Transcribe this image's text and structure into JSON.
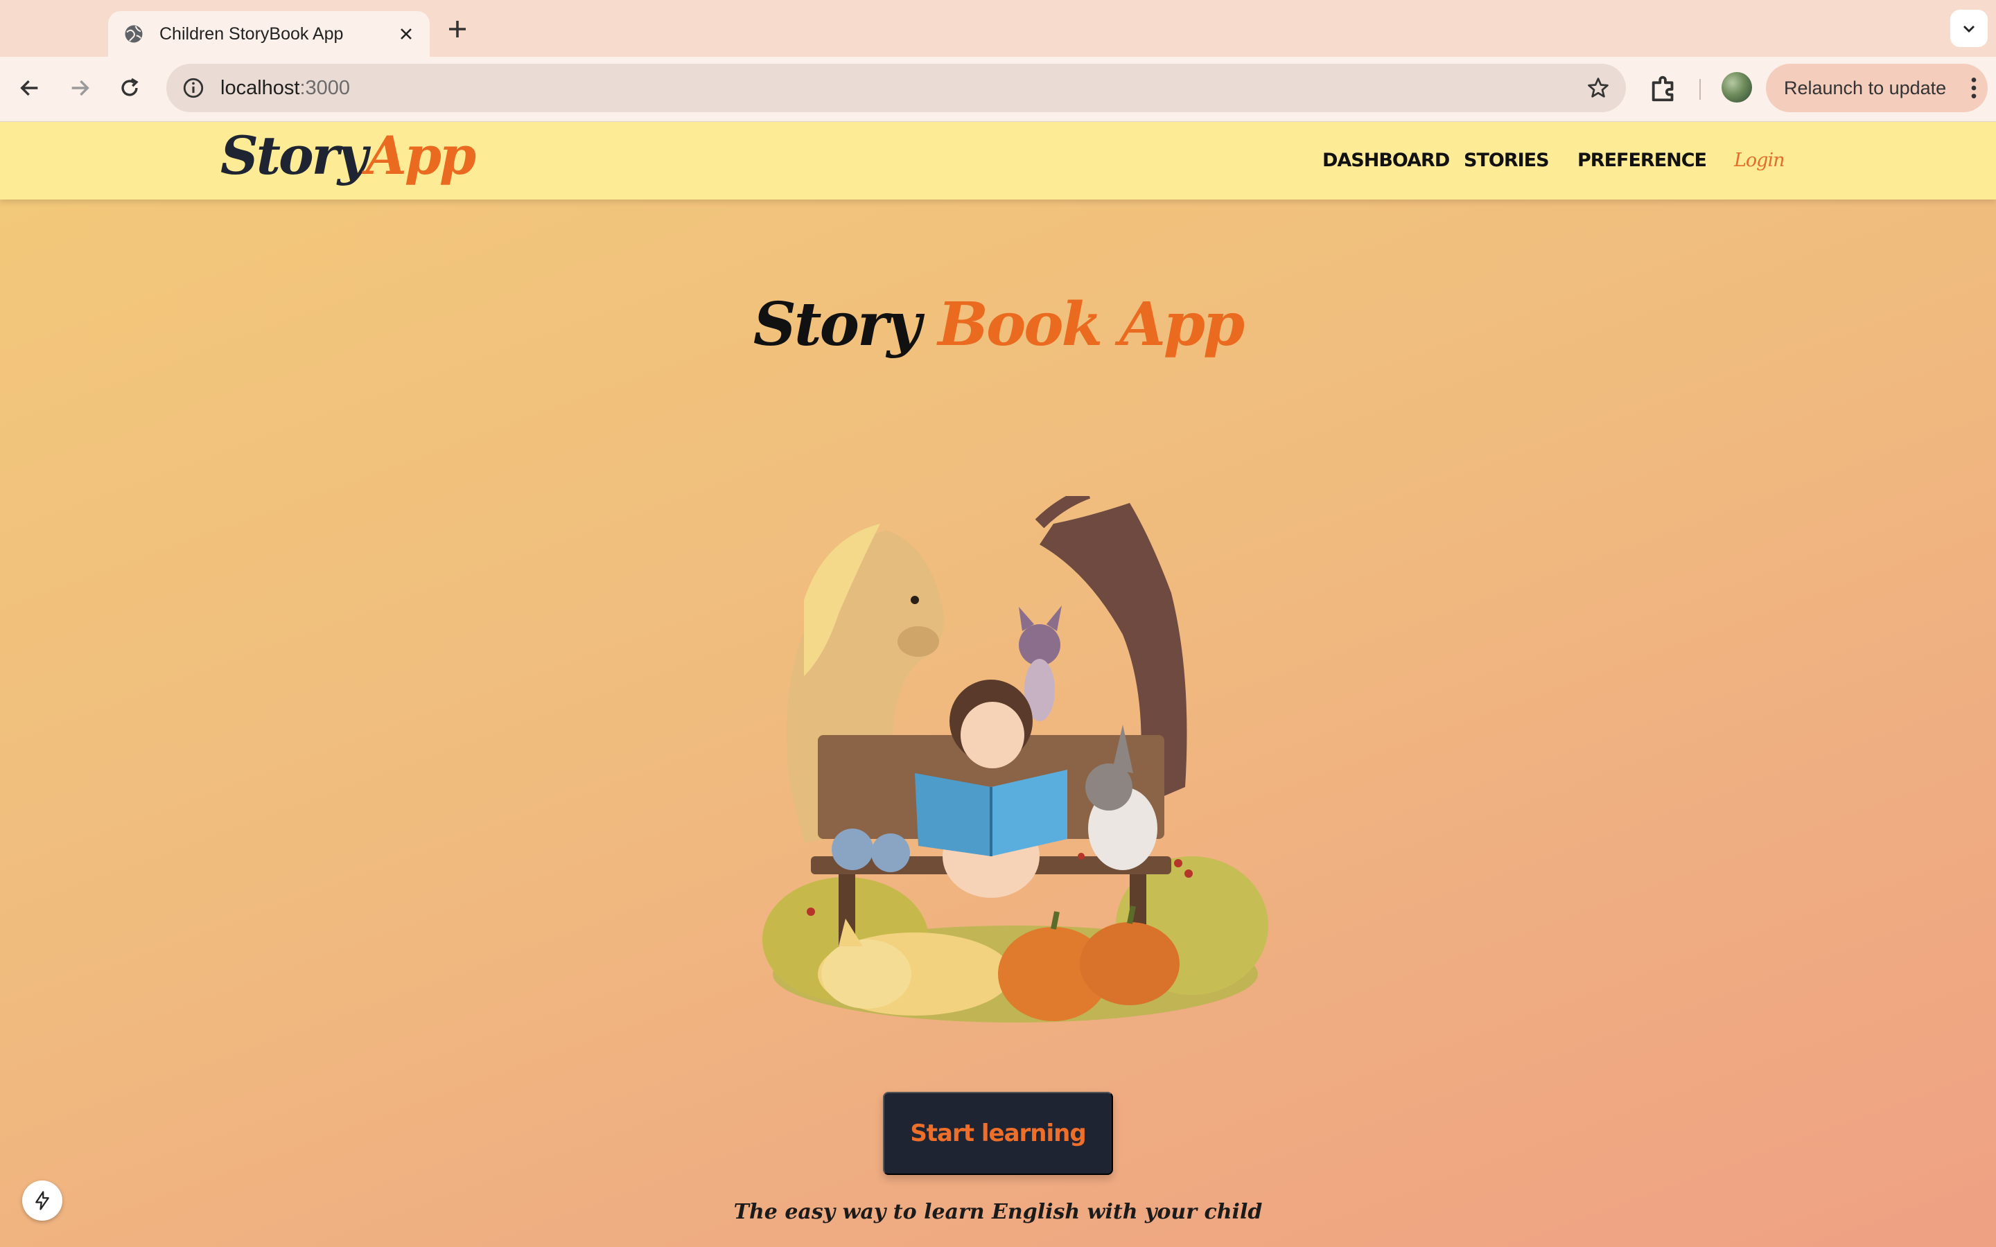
{
  "browser": {
    "tab_title": "Children StoryBook App",
    "url_host": "localhost",
    "url_port": ":3000",
    "relaunch_label": "Relaunch to update"
  },
  "nav": {
    "logo_part1": "Story",
    "logo_part2": "App",
    "links": [
      "DASHBOARD",
      "STORIES",
      "PREFERENCE"
    ],
    "login": "Login"
  },
  "hero": {
    "title_part1": "Story",
    "title_part2": "Book App",
    "cta": "Start learning",
    "tagline": "The easy way to learn English with your child"
  },
  "colors": {
    "accent_orange": "#ea6a1f",
    "navy": "#1f2433",
    "nav_yellow": "#fdeb95"
  }
}
